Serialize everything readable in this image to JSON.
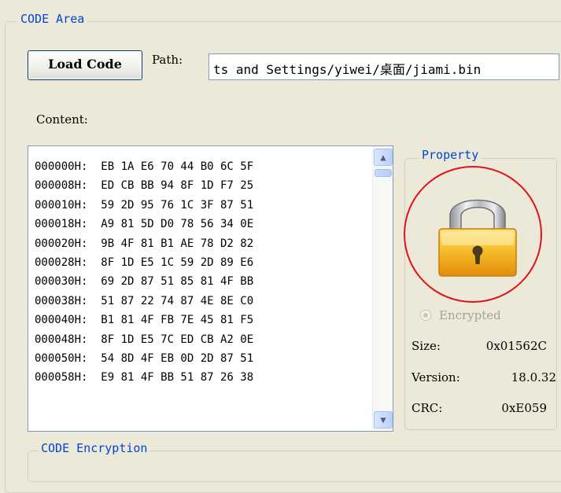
{
  "code_area": {
    "title": "CODE Area",
    "load_button": "Load Code",
    "path_label": "Path:",
    "path_value": "ts and Settings/yiwei/桌面/jiami.bin",
    "content_label": "Content:",
    "hex_lines": [
      "000000H:  EB 1A E6 70 44 B0 6C 5F",
      "000008H:  ED CB BB 94 8F 1D F7 25",
      "000010H:  59 2D 95 76 1C 3F 87 51",
      "000018H:  A9 81 5D D0 78 56 34 0E",
      "000020H:  9B 4F 81 B1 AE 78 D2 82",
      "000028H:  8F 1D E5 1C 59 2D 89 E6",
      "000030H:  69 2D 87 51 85 81 4F BB",
      "000038H:  51 87 22 74 87 4E 8E C0",
      "000040H:  B1 81 4F FB 7E 45 81 F5",
      "000048H:  8F 1D E5 7C ED CB A2 0E",
      "000050H:  54 8D 4F EB 0D 2D 87 51",
      "000058H:  E9 81 4F BB 51 87 26 38"
    ],
    "scroll_up_glyph": "▲",
    "scroll_down_glyph": "▼"
  },
  "property": {
    "title": "Property",
    "lock_icon": "padlock-locked-icon",
    "encrypted_label": "Encrypted",
    "encrypted_checked": true,
    "encrypted_enabled": false,
    "size_label": "Size:",
    "size_value": "0x01562C",
    "version_label": "Version:",
    "version_value": "18.0.32",
    "crc_label": "CRC:",
    "crc_value": "0xE059"
  },
  "encryption": {
    "title": "CODE Encryption"
  },
  "colors": {
    "window_bg": "#ece9d8",
    "group_title": "#0046d5",
    "annotation_circle": "#e0121e",
    "lock_gold": "#f2b21c"
  }
}
